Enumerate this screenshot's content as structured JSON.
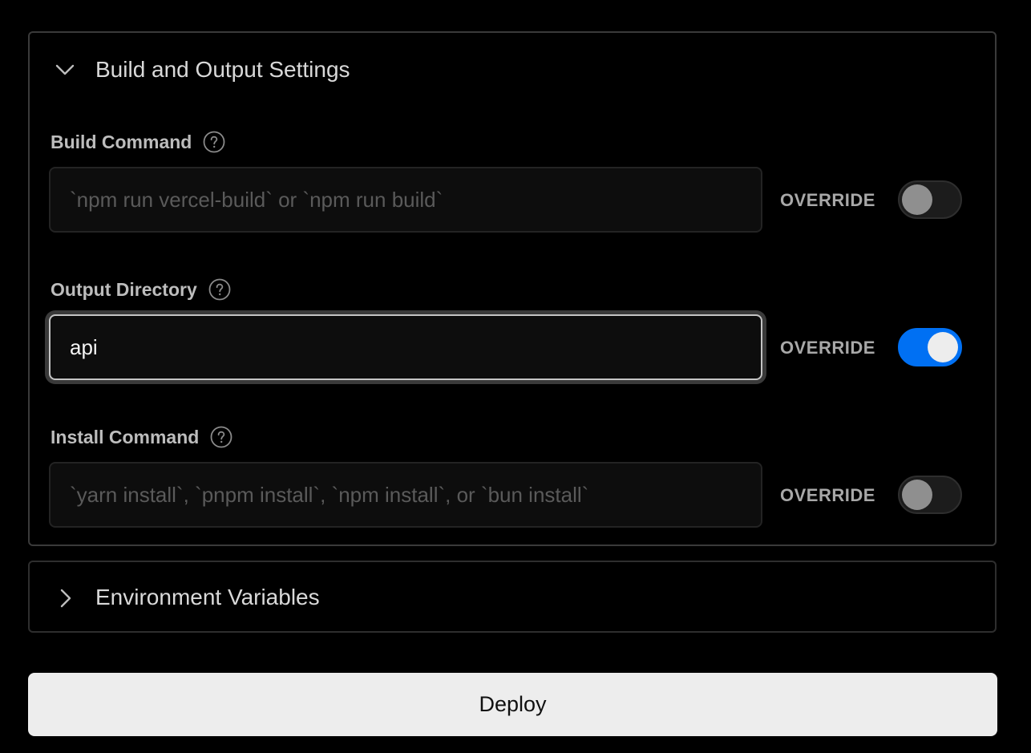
{
  "build_output_section": {
    "title": "Build and Output Settings",
    "expanded": true,
    "chevron_icon": "chevron-down-icon",
    "fields": [
      {
        "label": "Build Command",
        "help_icon": "question-circle-icon",
        "value": "",
        "placeholder": "`npm run vercel-build` or `npm run build`",
        "override_label": "OVERRIDE",
        "override_enabled": false
      },
      {
        "label": "Output Directory",
        "help_icon": "question-circle-icon",
        "value": "api",
        "placeholder": "",
        "override_label": "OVERRIDE",
        "override_enabled": true
      },
      {
        "label": "Install Command",
        "help_icon": "question-circle-icon",
        "value": "",
        "placeholder": "`yarn install`, `pnpm install`, `npm install`, or `bun install`",
        "override_label": "OVERRIDE",
        "override_enabled": false
      }
    ]
  },
  "env_section": {
    "title": "Environment Variables",
    "expanded": false,
    "chevron_icon": "chevron-right-icon"
  },
  "deploy_button": {
    "label": "Deploy"
  },
  "colors": {
    "background": "#000000",
    "toggle_on": "#0070f3",
    "toggle_off": "#1c1c1c",
    "deploy_bg": "#ededed"
  }
}
